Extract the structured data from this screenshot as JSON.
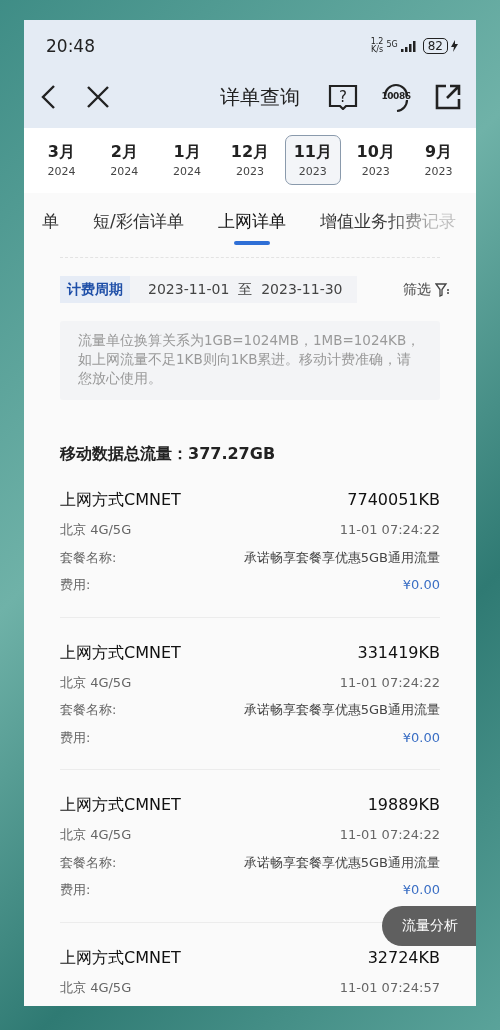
{
  "status_bar": {
    "time": "20:48",
    "net_speed_value": "1.2",
    "net_speed_unit": "K/s",
    "network": "5G",
    "battery": "82"
  },
  "nav": {
    "title": "详单查询",
    "help_mark": "?",
    "service_number": "10086"
  },
  "months": [
    {
      "month": "3月",
      "year": "2024",
      "selected": false
    },
    {
      "month": "2月",
      "year": "2024",
      "selected": false
    },
    {
      "month": "1月",
      "year": "2024",
      "selected": false
    },
    {
      "month": "12月",
      "year": "2023",
      "selected": false
    },
    {
      "month": "11月",
      "year": "2023",
      "selected": true
    },
    {
      "month": "10月",
      "year": "2023",
      "selected": false
    },
    {
      "month": "9月",
      "year": "2023",
      "selected": false
    }
  ],
  "tabs": [
    {
      "label": "单",
      "selected": false
    },
    {
      "label": "短/彩信详单",
      "selected": false
    },
    {
      "label": "上网详单",
      "selected": true
    },
    {
      "label": "增值业务扣费记录",
      "selected": false
    }
  ],
  "billing_period": {
    "label": "计费周期",
    "start": "2023-11-01",
    "separator": "至",
    "end": "2023-11-30",
    "filter": "筛选"
  },
  "note": "流量单位换算关系为1GB=1024MB，1MB=1024KB，如上网流量不足1KB则向1KB累进。移动计费准确，请您放心使用。",
  "total": {
    "label": "移动数据总流量：",
    "value": "377.27GB"
  },
  "records": [
    {
      "method": "上网方式CMNET",
      "amount": "7740051KB",
      "location": "北京 4G/5G",
      "time": "11-01 07:24:22",
      "package_label": "套餐名称:",
      "package": "承诺畅享套餐享优惠5GB通用流量",
      "fee_label": "费用:",
      "fee": "¥0.00"
    },
    {
      "method": "上网方式CMNET",
      "amount": "331419KB",
      "location": "北京 4G/5G",
      "time": "11-01 07:24:22",
      "package_label": "套餐名称:",
      "package": "承诺畅享套餐享优惠5GB通用流量",
      "fee_label": "费用:",
      "fee": "¥0.00"
    },
    {
      "method": "上网方式CMNET",
      "amount": "19889KB",
      "location": "北京 4G/5G",
      "time": "11-01 07:24:22",
      "package_label": "套餐名称:",
      "package": "承诺畅享套餐享优惠5GB通用流量",
      "fee_label": "费用:",
      "fee": "¥0.00"
    },
    {
      "method": "上网方式CMNET",
      "amount": "32724KB",
      "location": "北京 4G/5G",
      "time": "11-01 07:24:57"
    }
  ],
  "float_button": "流量分析"
}
